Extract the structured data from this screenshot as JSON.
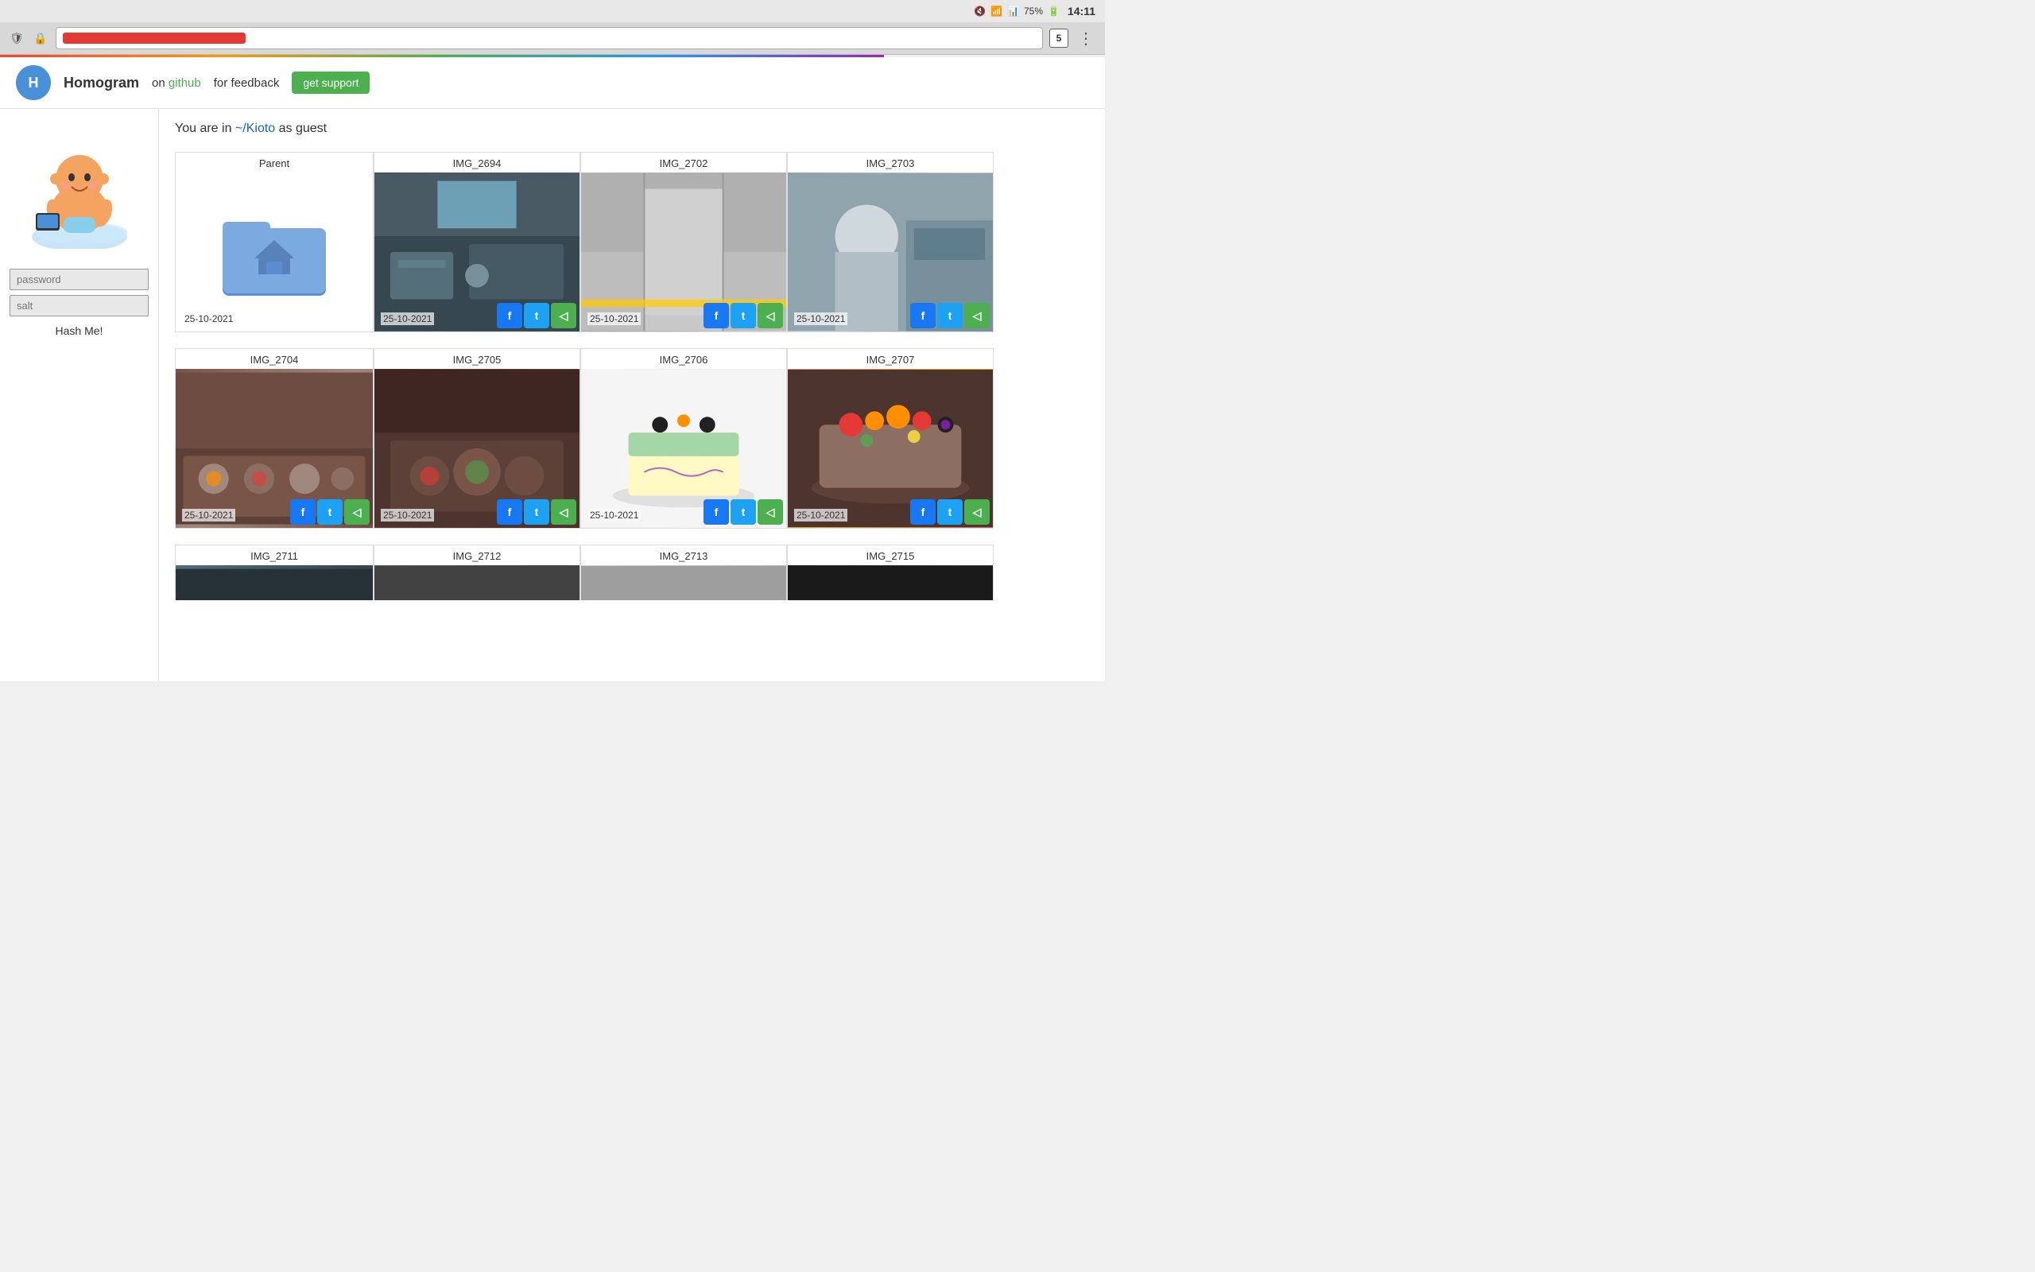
{
  "statusBar": {
    "time": "14:11",
    "battery": "75%",
    "tabCount": "5"
  },
  "header": {
    "appTitle": "Homogram",
    "navGithubPrefix": "on",
    "navGithubSuffix": "github",
    "navFeedbackPrefix": "for",
    "navFeedbackSuffix": "feedback",
    "btnSupport": "get support"
  },
  "breadcrumb": {
    "text": "You are in ",
    "path": "~/Kioto",
    "suffix": " as guest"
  },
  "sidebar": {
    "passwordPlaceholder": "password",
    "saltPlaceholder": "salt",
    "hashButton": "Hash Me!"
  },
  "rows": [
    {
      "items": [
        {
          "id": "parent",
          "title": "Parent",
          "type": "folder",
          "date": "25-10-2021",
          "hasShare": false
        },
        {
          "id": "img2694",
          "title": "IMG_2694",
          "type": "photo",
          "cls": "img-2694",
          "date": "25-10-2021",
          "hasShare": true
        },
        {
          "id": "img2702",
          "title": "IMG_2702",
          "type": "photo",
          "cls": "img-2702",
          "date": "25-10-2021",
          "hasShare": true
        },
        {
          "id": "img2703",
          "title": "IMG_2703",
          "type": "photo",
          "cls": "img-2703",
          "date": "25-10-2021",
          "hasShare": true
        }
      ]
    },
    {
      "items": [
        {
          "id": "img2704",
          "title": "IMG_2704",
          "type": "photo",
          "cls": "img-2704",
          "date": "25-10-2021",
          "hasShare": true
        },
        {
          "id": "img2705",
          "title": "IMG_2705",
          "type": "photo",
          "cls": "img-2705",
          "date": "25-10-2021",
          "hasShare": true
        },
        {
          "id": "img2706",
          "title": "IMG_2706",
          "type": "photo",
          "cls": "img-2706",
          "date": "25-10-2021",
          "hasShare": true
        },
        {
          "id": "img2707",
          "title": "IMG_2707",
          "type": "photo",
          "cls": "img-2707",
          "date": "25-10-2021",
          "hasShare": true
        }
      ]
    },
    {
      "items": [
        {
          "id": "img2711",
          "title": "IMG_2711",
          "type": "photo",
          "cls": "img-2711",
          "date": "",
          "hasShare": false
        },
        {
          "id": "img2712",
          "title": "IMG_2712",
          "type": "photo",
          "cls": "img-2712",
          "date": "",
          "hasShare": false
        },
        {
          "id": "img2713",
          "title": "IMG_2713",
          "type": "photo",
          "cls": "img-2713",
          "date": "",
          "hasShare": false
        },
        {
          "id": "img2715",
          "title": "IMG_2715",
          "type": "photo",
          "cls": "img-2715",
          "date": "",
          "hasShare": false
        }
      ]
    }
  ],
  "shareButtons": [
    {
      "id": "fb",
      "label": "f",
      "cls": "fb"
    },
    {
      "id": "tw",
      "label": "t",
      "cls": "tw"
    },
    {
      "id": "sh",
      "label": "◁",
      "cls": "sh"
    }
  ]
}
